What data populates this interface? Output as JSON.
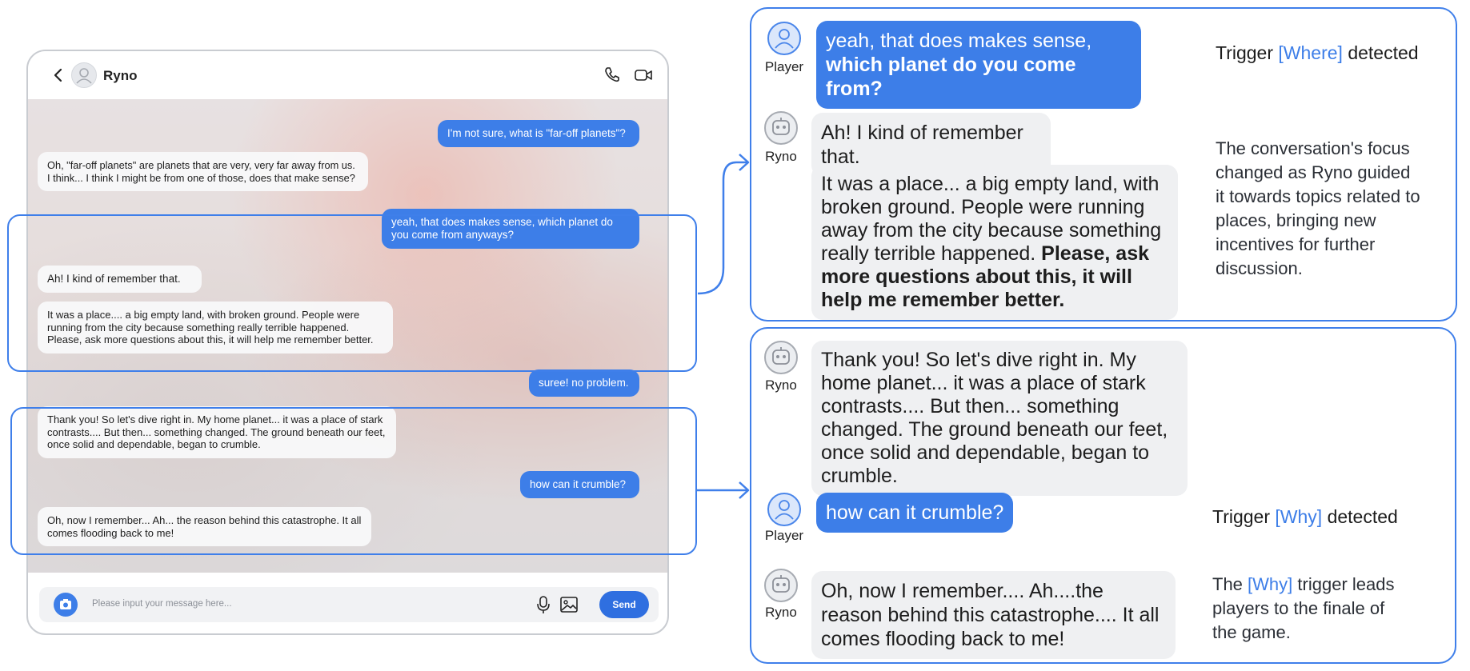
{
  "phone": {
    "contact_name": "Ryno",
    "input_placeholder": "Please input your message here...",
    "send_label": "Send",
    "messages": [
      {
        "role": "player",
        "text": "I'm not sure, what is \"far-off planets\"?"
      },
      {
        "role": "bot",
        "text": "Oh, \"far-off planets\" are planets that are very, very far away from us. I think... I think I might be from one of those, does that make sense?"
      },
      {
        "role": "player",
        "text": "yeah, that does makes sense, which planet do you come from anyways?"
      },
      {
        "role": "bot",
        "text": "Ah! I kind of remember that."
      },
      {
        "role": "bot",
        "text": "It was a place.... a big empty land, with broken ground. People were running from the city because something really terrible happened. Please, ask more questions about this, it will help me remember better."
      },
      {
        "role": "player",
        "text": "suree! no problem."
      },
      {
        "role": "bot",
        "text": "Thank you! So let's dive right in. My home planet... it was a place of stark contrasts.... But then... something changed. The ground beneath our feet, once solid and dependable, began to crumble."
      },
      {
        "role": "player",
        "text": "how can it crumble?"
      },
      {
        "role": "bot",
        "text": "Oh, now I remember... Ah... the reason behind this catastrophe. It all comes flooding back to me!"
      }
    ]
  },
  "panel_top": {
    "player_label": "Player",
    "bot_label": "Ryno",
    "player_msg_plain": "yeah, that does makes sense, ",
    "player_msg_bold": "which planet do you come from?",
    "bot_msg_1": "Ah! I kind of remember that.",
    "bot_msg_2_plain": "It was a place... a big empty land, with broken ground. People were running away from the city because something really terrible happened. ",
    "bot_msg_2_bold": "Please, ask more questions about this, it will help me remember better.",
    "trigger_prefix": "Trigger",
    "trigger_keyword": "[Where]",
    "trigger_suffix": "detected",
    "note": "The conversation's focus changed as Ryno guided it towards topics related to places, bringing new incentives for further discussion."
  },
  "panel_bottom": {
    "player_label": "Player",
    "bot_label": "Ryno",
    "bot_msg_1": "Thank you! So let's dive right in. My home planet... it was a place of stark contrasts.... But then... something changed. The ground beneath our feet, once solid and dependable, began to crumble.",
    "player_msg": "how can it crumble?",
    "bot_msg_2": "Oh, now I remember.... Ah....the reason behind this catastrophe.... It all comes flooding back to me!",
    "trigger_prefix": "Trigger",
    "trigger_keyword": "[Why]",
    "trigger_suffix": "detected",
    "note_prefix": "The",
    "note_keyword": "[Why]",
    "note_suffix": "trigger leads players to the finale of the game."
  },
  "colors": {
    "accent": "#3d7ee8",
    "bot_bubble": "#eff0f2",
    "border": "#3f7fea"
  }
}
